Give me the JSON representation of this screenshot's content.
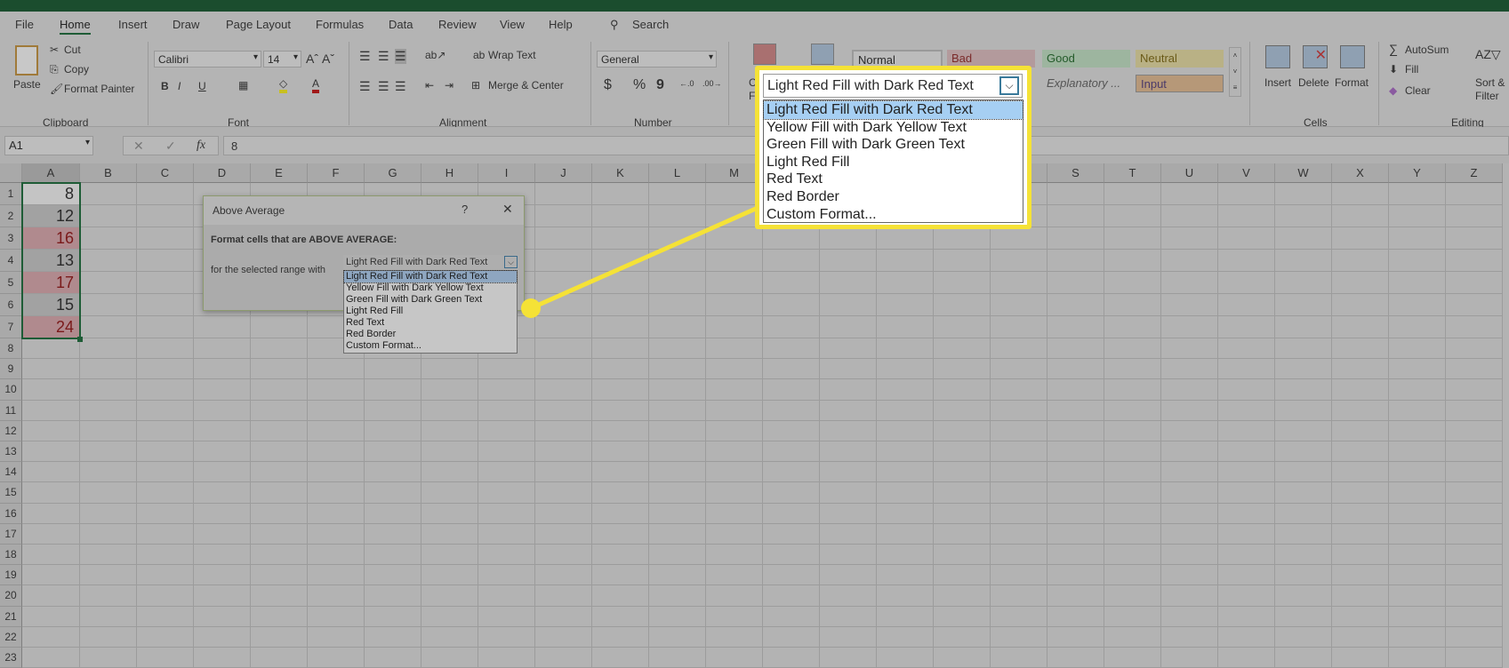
{
  "tabs": [
    "File",
    "Home",
    "Insert",
    "Draw",
    "Page Layout",
    "Formulas",
    "Data",
    "Review",
    "View",
    "Help"
  ],
  "search_label": "Search",
  "ribbon": {
    "clipboard": {
      "paste": "Paste",
      "cut": "Cut",
      "copy": "Copy",
      "format_painter": "Format Painter",
      "label": "Clipboard"
    },
    "font": {
      "font_name": "Calibri",
      "font_size": "14",
      "bold": "B",
      "italic": "I",
      "underline": "U",
      "label": "Font"
    },
    "alignment": {
      "wrap_text": "Wrap Text",
      "merge_center": "Merge & Center",
      "label": "Alignment"
    },
    "number": {
      "format": "General",
      "currency": "$",
      "percent": "%",
      "comma": "9",
      "label": "Number"
    },
    "styles": {
      "conditional_partial": "Con",
      "conditional_partial2": "Forn",
      "normal": "Normal",
      "bad": "Bad",
      "good": "Good",
      "neutral": "Neutral",
      "explanatory": "Explanatory ...",
      "input": "Input"
    },
    "cells": {
      "insert": "Insert",
      "delete": "Delete",
      "format": "Format",
      "label": "Cells"
    },
    "editing": {
      "autosum": "AutoSum",
      "fill": "Fill",
      "clear": "Clear",
      "sort1": "Sort &",
      "sort2": "Filter",
      "label": "Editing"
    }
  },
  "formula_bar": {
    "name_box": "A1",
    "fx": "fx",
    "content": "8"
  },
  "columns": [
    "A",
    "B",
    "C",
    "D",
    "E",
    "F",
    "G",
    "H",
    "I",
    "J",
    "K",
    "L",
    "M",
    "N",
    "O",
    "P",
    "Q",
    "R",
    "S",
    "T",
    "U",
    "V",
    "W",
    "X",
    "Y",
    "Z"
  ],
  "row_count": 23,
  "cells": [
    {
      "ref": "A1",
      "value": "8",
      "highlight": false
    },
    {
      "ref": "A2",
      "value": "12",
      "highlight": false
    },
    {
      "ref": "A3",
      "value": "16",
      "highlight": true
    },
    {
      "ref": "A4",
      "value": "13",
      "highlight": false
    },
    {
      "ref": "A5",
      "value": "17",
      "highlight": true
    },
    {
      "ref": "A6",
      "value": "15",
      "highlight": false
    },
    {
      "ref": "A7",
      "value": "24",
      "highlight": true
    }
  ],
  "dialog": {
    "title": "Above Average",
    "help": "?",
    "close": "✕",
    "heading": "Format cells that are ABOVE AVERAGE:",
    "range_label": "for the selected range with",
    "selected": "Light Red Fill with Dark Red Text",
    "options": [
      "Light Red Fill with Dark Red Text",
      "Yellow Fill with Dark Yellow Text",
      "Green Fill with Dark Green Text",
      "Light Red Fill",
      "Red Text",
      "Red Border",
      "Custom Format..."
    ]
  },
  "callout": {
    "color": "#f5e236"
  },
  "colors": {
    "accent": "#1e5c36",
    "highlight_fill": "#b08a8e",
    "highlight_text": "#7a1a1a"
  }
}
